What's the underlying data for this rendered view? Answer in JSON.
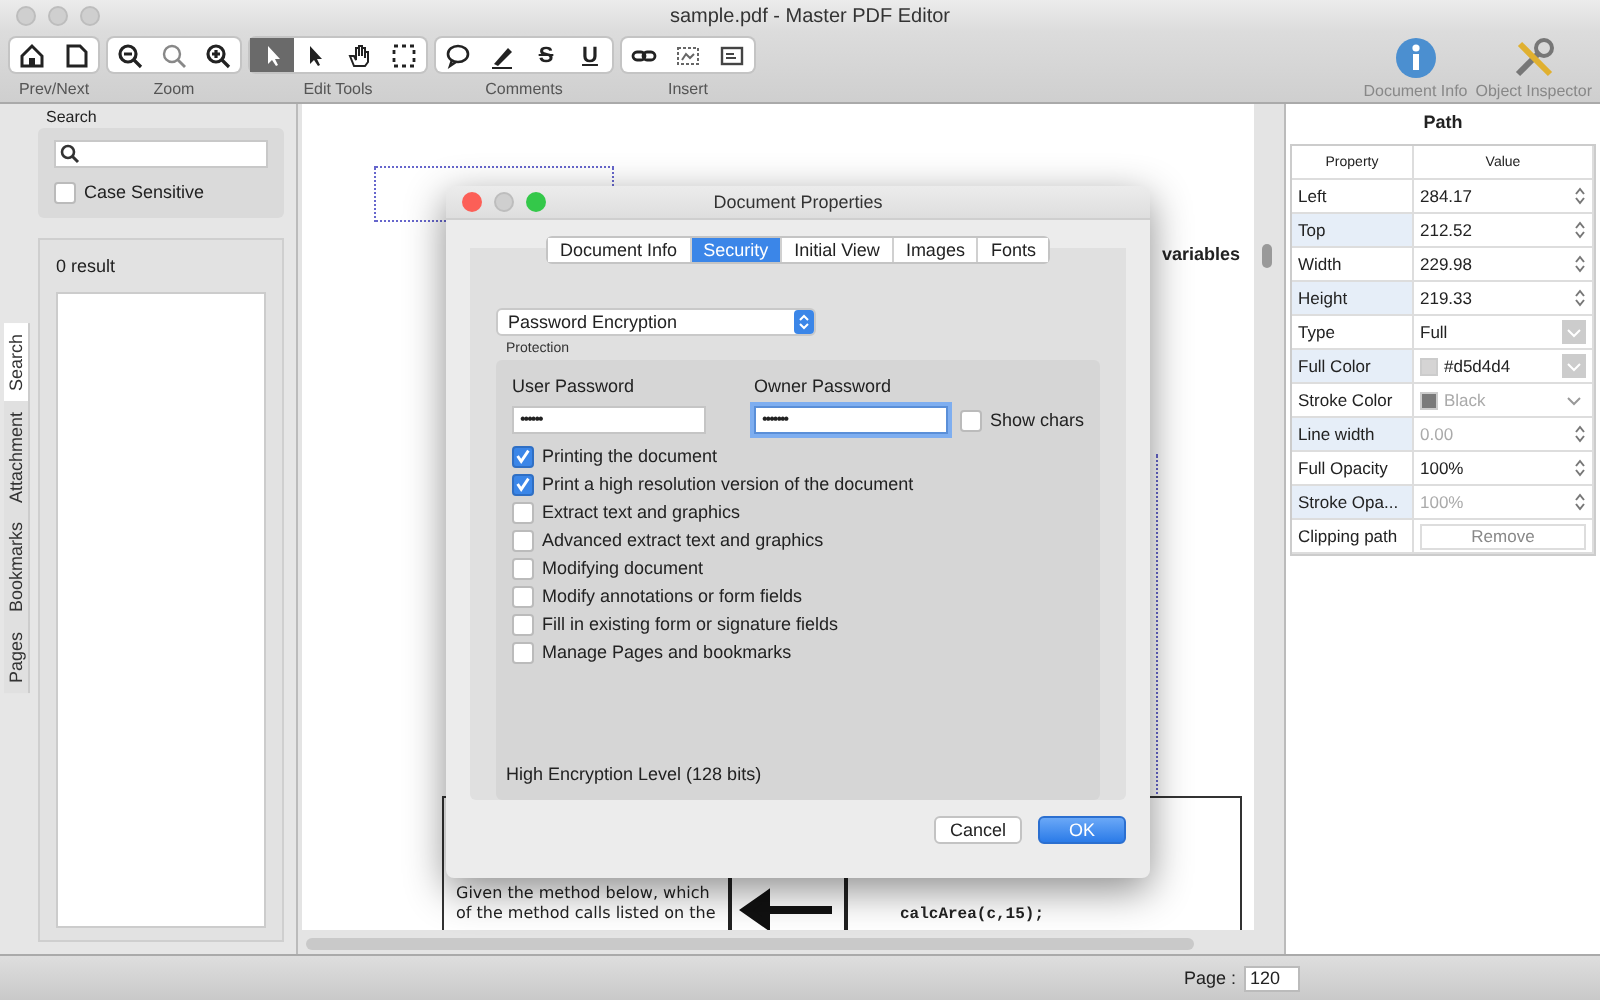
{
  "window": {
    "title": "sample.pdf - Master PDF Editor"
  },
  "toolbar": {
    "groups": [
      {
        "label": "Prev/Next",
        "tools": [
          {
            "kind": "icon",
            "selected": false
          },
          {
            "kind": "icon",
            "selected": false
          }
        ]
      },
      {
        "label": "Zoom",
        "tools": [
          {
            "kind": "icon",
            "selected": false
          },
          {
            "kind": "icon",
            "selected": false
          },
          {
            "kind": "icon",
            "selected": false
          }
        ]
      },
      {
        "label": "Edit Tools",
        "tools": [
          {
            "kind": "icon",
            "selected": true
          },
          {
            "kind": "icon",
            "selected": false
          },
          {
            "kind": "icon",
            "selected": false
          },
          {
            "kind": "icon",
            "selected": false
          }
        ]
      },
      {
        "label": "Comments",
        "tools": [
          {
            "kind": "icon",
            "selected": false
          },
          {
            "kind": "icon",
            "selected": false
          },
          {
            "kind": "glyph",
            "glyph": "S",
            "selected": false
          },
          {
            "kind": "glyph",
            "glyph": "U",
            "selected": false
          }
        ]
      },
      {
        "label": "Insert",
        "tools": [
          {
            "kind": "icon",
            "selected": false
          },
          {
            "kind": "icon",
            "selected": false
          },
          {
            "kind": "icon",
            "selected": false
          }
        ]
      }
    ],
    "right": [
      {
        "label": "Document Info"
      },
      {
        "label": "Object Inspector"
      }
    ]
  },
  "search_panel": {
    "title": "Search",
    "case_sensitive": {
      "label": "Case Sensitive",
      "checked": false
    },
    "result_count": "0 result"
  },
  "side_tabs": [
    {
      "label": "Pages",
      "selected": false
    },
    {
      "label": "Bookmarks",
      "selected": false
    },
    {
      "label": "Attachment",
      "selected": false
    },
    {
      "label": "Search",
      "selected": true
    }
  ],
  "document": {
    "heading": "variables",
    "question": [
      "Given the method below, which",
      "of the method calls listed on the"
    ],
    "code": "calcArea(c,15);"
  },
  "dialog": {
    "title": "Document Properties",
    "tabs": [
      {
        "label": "Document Info",
        "selected": false
      },
      {
        "label": "Security",
        "selected": true
      },
      {
        "label": "Initial View",
        "selected": false
      },
      {
        "label": "Images",
        "selected": false
      },
      {
        "label": "Fonts",
        "selected": false
      }
    ],
    "encryption": "Password Encryption",
    "group_label": "Protection",
    "passwords": [
      {
        "label": "User Password",
        "value": "••••••",
        "focused": false
      },
      {
        "label": "Owner Password",
        "value": "•••••••",
        "focused": true
      }
    ],
    "show_chars": {
      "label": "Show chars",
      "checked": false
    },
    "permissions": [
      {
        "label": "Printing the document",
        "checked": true
      },
      {
        "label": "Print a high resolution version of the document",
        "checked": true
      },
      {
        "label": "Extract text and graphics",
        "checked": false
      },
      {
        "label": "Advanced extract text and graphics",
        "checked": false
      },
      {
        "label": "Modifying document",
        "checked": false
      },
      {
        "label": "Modify annotations or form fields",
        "checked": false
      },
      {
        "label": "Fill in existing form or signature fields",
        "checked": false
      },
      {
        "label": "Manage Pages and bookmarks",
        "checked": false
      }
    ],
    "level_text": "High Encryption Level (128 bits)",
    "buttons": [
      {
        "label": "Cancel",
        "default": false
      },
      {
        "label": "OK",
        "default": true
      }
    ]
  },
  "inspector": {
    "title": "Path",
    "columns": [
      "Property",
      "Value"
    ],
    "rows": [
      {
        "property": "Left",
        "kind": "spin",
        "value": "284.17",
        "disabled": false
      },
      {
        "property": "Top",
        "kind": "spin",
        "value": "212.52",
        "disabled": false
      },
      {
        "property": "Width",
        "kind": "spin",
        "value": "229.98",
        "disabled": false
      },
      {
        "property": "Height",
        "kind": "spin",
        "value": "219.33",
        "disabled": false
      },
      {
        "property": "Type",
        "kind": "select",
        "value": "Full",
        "disabled": false
      },
      {
        "property": "Full Color",
        "kind": "color",
        "value": "#d5d4d4",
        "color": "#d5d4d4",
        "disabled": false
      },
      {
        "property": "Stroke Color",
        "kind": "color",
        "value": "Black",
        "color": "#7a7a7a",
        "disabled": true
      },
      {
        "property": "Line width",
        "kind": "spin",
        "value": "0.00",
        "disabled": true
      },
      {
        "property": "Full Opacity",
        "kind": "spin",
        "value": "100%",
        "disabled": false
      },
      {
        "property": "Stroke Opa...",
        "kind": "spin",
        "value": "100%",
        "disabled": true
      },
      {
        "property": "Clipping path",
        "kind": "button",
        "value": "Remove",
        "disabled": false
      }
    ]
  },
  "status_bar": {
    "page_label": "Page :",
    "page": "120"
  }
}
